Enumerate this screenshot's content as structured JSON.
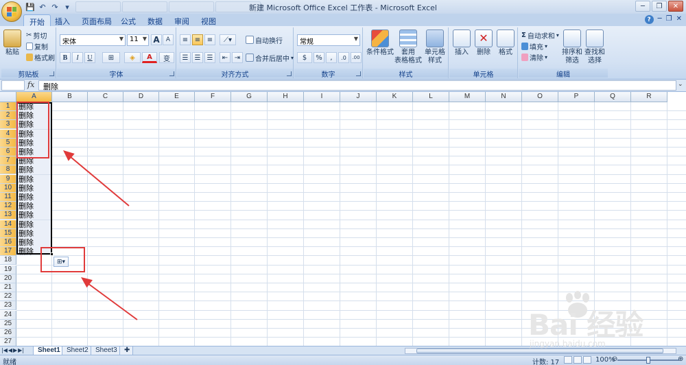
{
  "titlebar": {
    "title": "新建 Microsoft Office Excel 工作表 - Microsoft Excel",
    "minimize": "─",
    "restore": "❐",
    "close": "✕"
  },
  "qat": {
    "save": "💾",
    "undo": "↶",
    "redo": "↷",
    "customize": "▾"
  },
  "tabs": [
    "开始",
    "插入",
    "页面布局",
    "公式",
    "数据",
    "审阅",
    "视图"
  ],
  "tab_right": {
    "help": "?",
    "min": "─",
    "restore": "❐",
    "close": "✕"
  },
  "ribbon": {
    "clipboard": {
      "label": "剪贴板",
      "paste": "粘贴",
      "cut": "剪切",
      "copy": "复制",
      "format_painter": "格式刷"
    },
    "font": {
      "label": "字体",
      "font_name": "宋体",
      "font_size": "11",
      "grow": "A",
      "shrink": "A",
      "bold": "B",
      "italic": "I",
      "underline": "U",
      "border": "⊞",
      "fill": "◈",
      "font_color": "A",
      "phonetic": "变"
    },
    "alignment": {
      "label": "对齐方式",
      "wrap": "自动换行",
      "merge": "合并后居中"
    },
    "number": {
      "label": "数字",
      "format": "常规",
      "currency": "$",
      "percent": "%",
      "comma": ",",
      "inc_dec": ".0",
      "dec_dec": ".00"
    },
    "styles": {
      "label": "样式",
      "conditional": "条件格式",
      "table_line1": "套用",
      "table_line2": "表格格式",
      "cell_line1": "单元格",
      "cell_line2": "样式"
    },
    "cells": {
      "label": "单元格",
      "insert": "插入",
      "delete": "删除",
      "format": "格式"
    },
    "editing": {
      "label": "编辑",
      "autosum": "自动求和",
      "fill": "填充",
      "clear": "清除",
      "sort_line1": "排序和",
      "sort_line2": "筛选",
      "find_line1": "查找和",
      "find_line2": "选择"
    }
  },
  "formula_bar": {
    "name_box": "",
    "fx": "fx",
    "content": "删除"
  },
  "columns": [
    "A",
    "B",
    "C",
    "D",
    "E",
    "F",
    "G",
    "H",
    "I",
    "J",
    "K",
    "L",
    "M",
    "N",
    "O",
    "P",
    "Q",
    "R"
  ],
  "rows": [
    "1",
    "2",
    "3",
    "4",
    "5",
    "6",
    "7",
    "8",
    "9",
    "10",
    "11",
    "12",
    "13",
    "14",
    "15",
    "16",
    "17",
    "18",
    "19",
    "20",
    "21",
    "22",
    "23",
    "24",
    "25",
    "26",
    "27"
  ],
  "cells_a": [
    "删除",
    "删除",
    "删除",
    "删除",
    "删除",
    "删除",
    "删除",
    "删除",
    "删除",
    "删除",
    "删除",
    "删除",
    "删除",
    "删除",
    "删除",
    "删除",
    "删除"
  ],
  "autofill_options": {
    "icon": "⊞▾"
  },
  "sheets": [
    "Sheet1",
    "Sheet2",
    "Sheet3"
  ],
  "status": {
    "ready": "就绪",
    "count": "计数: 17",
    "zoom": "100%",
    "zoom_out": "⊖",
    "zoom_in": "⊕"
  },
  "watermark": {
    "brand": "Bai 经验",
    "url": "jingyan.baidu.com"
  },
  "colors": {
    "accent": "#f4b944",
    "annotation_red": "#e03a3a",
    "ribbon_blue": "#15428b"
  }
}
